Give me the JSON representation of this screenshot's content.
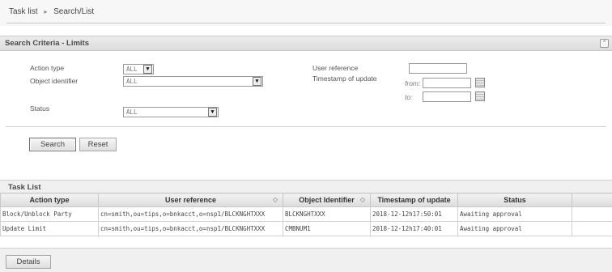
{
  "breadcrumb": {
    "item1": "Task list",
    "separator": "▸",
    "item2": "Search/List"
  },
  "search_panel": {
    "title": "Search Criteria - Limits",
    "collapse_icon": "double-chevron-up-icon",
    "action_type": {
      "label": "Action type",
      "value": "ALL"
    },
    "object_identifier": {
      "label": "Object identifier",
      "value": "ALL"
    },
    "status": {
      "label": "Status",
      "value": "ALL"
    },
    "user_reference": {
      "label": "User reference",
      "value": ""
    },
    "timestamp": {
      "label": "Timestamp of update",
      "from_label": "from:",
      "to_label": "to:",
      "from_value": "",
      "to_value": ""
    },
    "search_label": "Search",
    "reset_label": "Reset"
  },
  "task_list": {
    "title": "Task List",
    "columns": [
      "Action type",
      "User reference",
      "Object Identifier",
      "Timestamp of update",
      "Status"
    ],
    "sort_glyph": "◇",
    "rows": [
      [
        "Block/Unblock Party",
        "cn=smith,ou=tips,o=bnkacct,o=nsp1/BLCKNGHTXXX",
        "BLCKNGHTXXX",
        "2018-12-12h17:50:01",
        "Awaiting approval"
      ],
      [
        "Update Limit",
        "cn=smith,ou=tips,o=bnkacct,o=nsp1/BLCKNGHTXXX",
        "CMBNUM1",
        "2018-12-12h17:40:01",
        "Awaiting approval"
      ]
    ]
  },
  "details_label": "Details"
}
